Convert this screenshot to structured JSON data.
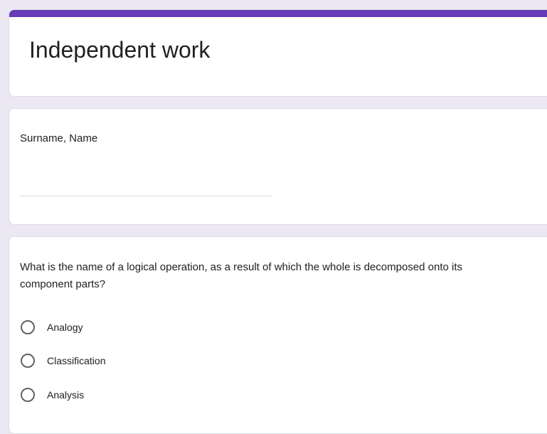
{
  "colors": {
    "accent": "#673ab7",
    "background": "#ece8f3",
    "card": "#ffffff",
    "divider": "#dadce0"
  },
  "form": {
    "title": "Independent work"
  },
  "name_question": {
    "label": "Surname, Name",
    "value": ""
  },
  "choice_question": {
    "text": "What is the name of a logical operation, as a result of which the whole is decomposed onto its component parts?",
    "options": [
      {
        "label": "Analogy",
        "selected": false
      },
      {
        "label": "Classification",
        "selected": false
      },
      {
        "label": "Analysis",
        "selected": false
      }
    ]
  }
}
